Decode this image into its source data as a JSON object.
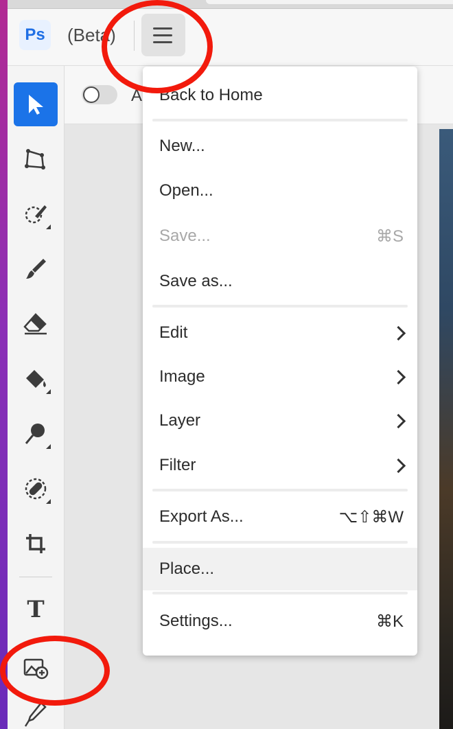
{
  "app": {
    "logo_text": "Ps",
    "beta_label": "(Beta)"
  },
  "options_bar": {
    "partial_text": "A"
  },
  "toolbar": {
    "tools": [
      "move-select-icon",
      "polygon-lasso-icon",
      "quick-selection-icon",
      "brush-icon",
      "eraser-icon",
      "paint-bucket-icon",
      "dodge-icon",
      "healing-bandage-icon",
      "crop-icon",
      "type-icon",
      "place-image-icon",
      "eyedropper-icon"
    ],
    "type_glyph": "T"
  },
  "menu": {
    "items": [
      {
        "label": "Back to Home",
        "shortcut": "",
        "submenu": false,
        "disabled": false
      },
      {
        "label": "New...",
        "shortcut": "",
        "submenu": false,
        "disabled": false
      },
      {
        "label": "Open...",
        "shortcut": "",
        "submenu": false,
        "disabled": false
      },
      {
        "label": "Save...",
        "shortcut": "⌘S",
        "submenu": false,
        "disabled": true
      },
      {
        "label": "Save as...",
        "shortcut": "",
        "submenu": false,
        "disabled": false
      },
      {
        "label": "Edit",
        "shortcut": "",
        "submenu": true,
        "disabled": false
      },
      {
        "label": "Image",
        "shortcut": "",
        "submenu": true,
        "disabled": false
      },
      {
        "label": "Layer",
        "shortcut": "",
        "submenu": true,
        "disabled": false
      },
      {
        "label": "Filter",
        "shortcut": "",
        "submenu": true,
        "disabled": false
      },
      {
        "label": "Export As...",
        "shortcut": "⌥⇧⌘W",
        "submenu": false,
        "disabled": false
      },
      {
        "label": "Place...",
        "shortcut": "",
        "submenu": false,
        "disabled": false
      },
      {
        "label": "Settings...",
        "shortcut": "⌘K",
        "submenu": false,
        "disabled": false
      }
    ]
  },
  "colors": {
    "accent": "#1b73e8",
    "annotation_red": "#f21a0c"
  }
}
